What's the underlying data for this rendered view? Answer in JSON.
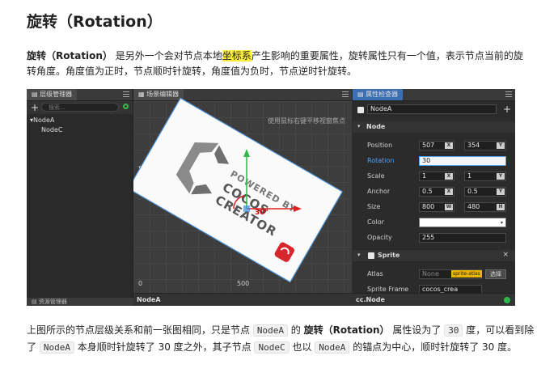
{
  "article": {
    "title": "旋转（Rotation）",
    "p1_b1": "旋转（Rotation）",
    "p1_t1": " 是另外一个会对节点本地",
    "p1_hl": "坐标系",
    "p1_t2": "产生影响的重要属性，旋转属性只有一个值，表示节点当前的旋转角度。角度值为正时，节点顺时针旋转，角度值为负时，节点逆时针旋转。",
    "p2_t1": "上图所示的节点层级关系和前一张图相同，只是节点 ",
    "p2_c1": "NodeA",
    "p2_t2": " 的 ",
    "p2_b1": "旋转（Rotation）",
    "p2_t3": " 属性设为了 ",
    "p2_c2": "30",
    "p2_t4": " 度，可以看到除了 ",
    "p2_c3": "NodeA",
    "p2_t5": " 本身顺时针旋转了 30 度之外，其子节点 ",
    "p2_c4": "NodeC",
    "p2_t6": " 也以 ",
    "p2_c5": "NodeA",
    "p2_t7": " 的锚点为中心，顺时针旋转了 30 度。"
  },
  "editor": {
    "hierarchy": {
      "title": "层级管理器",
      "search_placeholder": "搜索...",
      "nodes": [
        "NodeA",
        "NodeC"
      ],
      "bottom_tab": "资源管理器"
    },
    "scene": {
      "title": "场景编辑器",
      "hint": "使用鼠标右键平移视窗焦点",
      "y_tick": "500",
      "origin_tick": "0",
      "x_tick": "500",
      "rotation_label": "30°",
      "logo_line1": "POWERED BY",
      "logo_line2": "COCOS CREATOR",
      "footer": "NodeA"
    },
    "inspector": {
      "title": "属性检查器",
      "node_name": "NodeA",
      "section_node": "Node",
      "position_label": "Position",
      "position_x": "507",
      "position_y": "354",
      "rotation_label": "Rotation",
      "rotation_value": "30",
      "scale_label": "Scale",
      "scale_x": "1",
      "scale_y": "1",
      "anchor_label": "Anchor",
      "anchor_x": "0.5",
      "anchor_y": "0.5",
      "size_label": "Size",
      "size_w": "800",
      "size_h": "480",
      "color_label": "Color",
      "opacity_label": "Opacity",
      "opacity_value": "255",
      "section_sprite": "Sprite",
      "atlas_label": "Atlas",
      "atlas_value": "None",
      "atlas_badge": "sprite-atlas",
      "select_btn": "选择",
      "spriteframe_label": "Sprite Frame",
      "spriteframe_value": "cocos_crea",
      "tag_x": "X",
      "tag_y": "Y",
      "tag_w": "W",
      "tag_h": "H",
      "footer": "cc.Node"
    }
  },
  "colors": {
    "highlight": "#ffef3a",
    "panel_bg": "#2b2b2b",
    "accent_blue": "#3b8edf",
    "gizmo_green": "#2fb84b",
    "gizmo_red": "#e02020",
    "logo_red": "#d8262e"
  }
}
